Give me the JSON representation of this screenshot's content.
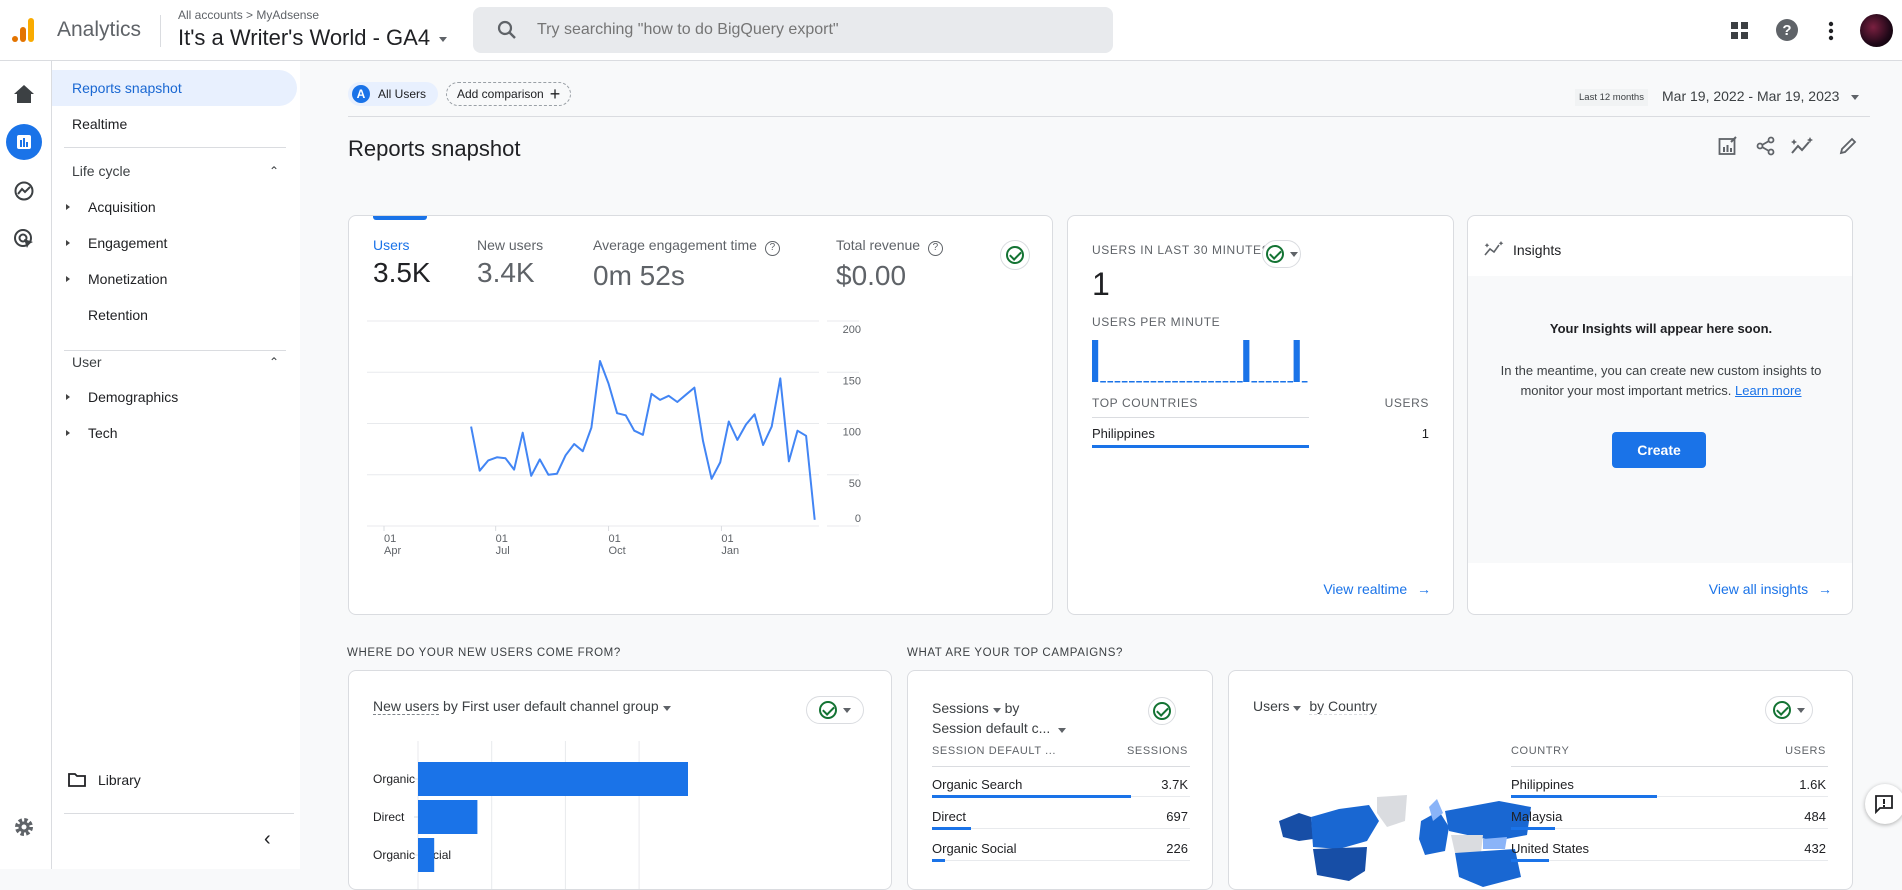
{
  "header": {
    "app_name": "Analytics",
    "breadcrumb": [
      "All accounts",
      "MyAdsense"
    ],
    "property_name": "It's a Writer's World - GA4",
    "search_placeholder": "Try searching \"how to do BigQuery export\"",
    "icons": [
      "apps-grid-icon",
      "help-icon",
      "more-vert-icon",
      "avatar"
    ]
  },
  "rail": {
    "icons": [
      "home-icon",
      "reports-icon",
      "explore-icon",
      "advertising-icon",
      "settings-icon"
    ]
  },
  "sidebar": {
    "top_items": [
      {
        "label": "Reports snapshot",
        "active": true
      },
      {
        "label": "Realtime"
      }
    ],
    "lifecycle": {
      "label": "Life cycle",
      "items": [
        "Acquisition",
        "Engagement",
        "Monetization",
        "Retention"
      ]
    },
    "user": {
      "label": "User",
      "items": [
        "Demographics",
        "Tech"
      ]
    },
    "library_label": "Library"
  },
  "toolbar": {
    "segment_badge": "A",
    "segment_label": "All Users",
    "add_comparison": "Add comparison",
    "date_preset": "Last 12 months",
    "date_range": "Mar 19, 2022 - Mar 19, 2023",
    "page_title": "Reports snapshot"
  },
  "overview": {
    "metrics": [
      {
        "label": "Users",
        "value": "3.5K",
        "active": true
      },
      {
        "label": "New users",
        "value": "3.4K"
      },
      {
        "label": "Average engagement time",
        "value": "0m 52s",
        "help": true
      },
      {
        "label": "Total revenue",
        "value": "$0.00",
        "help": true
      }
    ]
  },
  "realtime": {
    "title": "USERS IN LAST 30 MINUTES",
    "value": "1",
    "per_minute_label": "USERS PER MINUTE",
    "per_minute": [
      1,
      0,
      0,
      0,
      0,
      0,
      0,
      0,
      0,
      0,
      0,
      0,
      0,
      0,
      0,
      0,
      0,
      0,
      0,
      0,
      0,
      1,
      0,
      0,
      0,
      0,
      0,
      0,
      1,
      0
    ],
    "countries_header": "TOP COUNTRIES",
    "users_header": "USERS",
    "rows": [
      {
        "country": "Philippines",
        "users": "1"
      }
    ],
    "view_link": "View realtime"
  },
  "insights": {
    "title": "Insights",
    "headline": "Your Insights will appear here soon.",
    "body": "In the meantime, you can create new custom insights to monitor your most important metrics.",
    "learn_more": "Learn more",
    "create_label": "Create",
    "view_link": "View all insights"
  },
  "sections": {
    "new_users_heading": "WHERE DO YOUR NEW USERS COME FROM?",
    "campaigns_heading": "WHAT ARE YOUR TOP CAMPAIGNS?"
  },
  "new_users_card": {
    "metric": "New users",
    "by": "by",
    "dimension": "First user default channel group"
  },
  "campaigns_card": {
    "metric": "Sessions",
    "by": "by",
    "dimension": "Session default c...",
    "col1": "SESSION DEFAULT ...",
    "col2": "SESSIONS",
    "rows": [
      {
        "label": "Organic Search",
        "value": "3.7K",
        "share": 0.77
      },
      {
        "label": "Direct",
        "value": "697",
        "share": 0.15
      },
      {
        "label": "Organic Social",
        "value": "226",
        "share": 0.05
      }
    ]
  },
  "country_card": {
    "metric": "Users",
    "by": "by Country",
    "col1": "COUNTRY",
    "col2": "USERS",
    "rows": [
      {
        "label": "Philippines",
        "value": "1.6K",
        "share": 0.46
      },
      {
        "label": "Malaysia",
        "value": "484",
        "share": 0.14
      },
      {
        "label": "United States",
        "value": "432",
        "share": 0.12
      }
    ]
  },
  "colors": {
    "accent": "#1a73e8",
    "check": "#137333",
    "map_dark": "#174ea6",
    "map_mid": "#1967d2",
    "map_light": "#8ab4f8",
    "map_none": "#dadce0"
  },
  "chart_data": [
    {
      "type": "line",
      "series": [
        {
          "name": "Users",
          "values": [
            97,
            54,
            64,
            67,
            66,
            55,
            91,
            49,
            65,
            50,
            51,
            69,
            80,
            73,
            96,
            161,
            139,
            110,
            108,
            93,
            89,
            129,
            123,
            127,
            121,
            128,
            135,
            83,
            46,
            62,
            102,
            84,
            99,
            109,
            79,
            97,
            144,
            63,
            93,
            88,
            6
          ]
        }
      ],
      "x": [
        "2022-06-11",
        "2022-06-18",
        "2022-06-25",
        "2022-07-02",
        "2022-07-09",
        "2022-07-16",
        "2022-07-23",
        "2022-07-30",
        "2022-08-06",
        "2022-08-13",
        "2022-08-20",
        "2022-08-27",
        "2022-09-03",
        "2022-09-10",
        "2022-09-17",
        "2022-09-24",
        "2022-10-01",
        "2022-10-08",
        "2022-10-15",
        "2022-10-22",
        "2022-10-29",
        "2022-11-05",
        "2022-11-12",
        "2022-11-19",
        "2022-11-26",
        "2022-12-03",
        "2022-12-10",
        "2022-12-17",
        "2022-12-24",
        "2022-12-31",
        "2023-01-07",
        "2023-01-14",
        "2023-01-21",
        "2023-01-28",
        "2023-02-04",
        "2023-02-11",
        "2023-02-18",
        "2023-02-25",
        "2023-03-04",
        "2023-03-11",
        "2023-03-18"
      ],
      "xticks": [
        {
          "day": "01",
          "month": "Apr",
          "date": "2022-04-01"
        },
        {
          "day": "01",
          "month": "Jul",
          "date": "2022-07-01"
        },
        {
          "day": "01",
          "month": "Oct",
          "date": "2022-10-01"
        },
        {
          "day": "01",
          "month": "Jan",
          "date": "2023-01-01"
        }
      ],
      "yticks": [
        200,
        150,
        100,
        50,
        0
      ],
      "ylim": [
        0,
        200
      ],
      "grid": true,
      "y_axis_side": "right"
    },
    {
      "type": "bar",
      "orientation": "horizontal",
      "categories": [
        "Organic Search",
        "Direct",
        "Organic Social"
      ],
      "values_relative_percent": [
        100,
        22,
        6
      ]
    }
  ]
}
